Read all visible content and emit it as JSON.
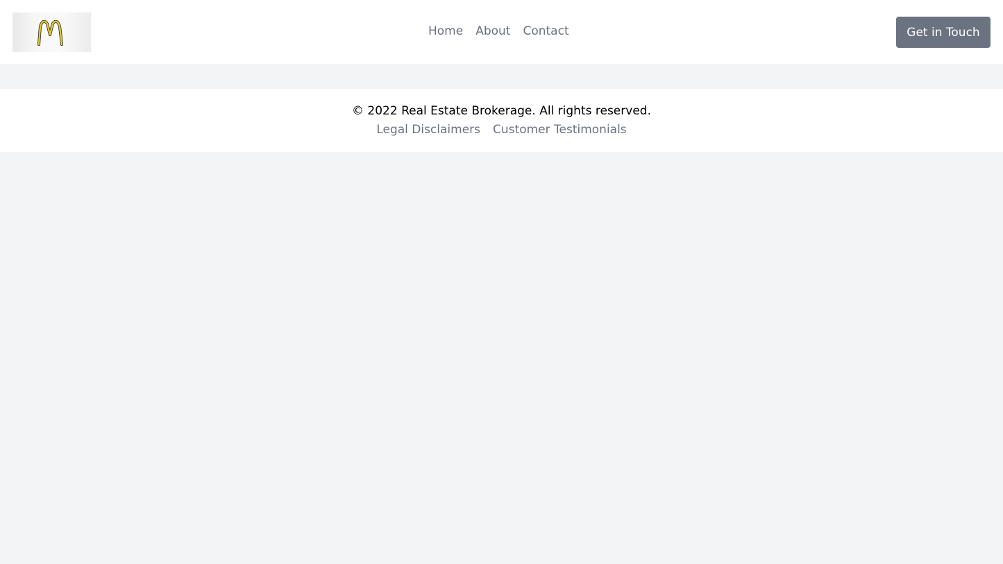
{
  "header": {
    "logo_icon": "golden-arches-logo-icon",
    "nav": [
      {
        "label": "Home"
      },
      {
        "label": "About"
      },
      {
        "label": "Contact"
      }
    ],
    "cta_label": "Get in Touch"
  },
  "footer": {
    "copyright": "© 2022 Real Estate Brokerage. All rights reserved.",
    "links": [
      {
        "label": "Legal Disclaimers"
      },
      {
        "label": "Customer Testimonials"
      }
    ]
  },
  "colors": {
    "page_background": "#f3f4f6",
    "surface": "#ffffff",
    "muted_text": "#6b7280",
    "button_bg": "#6b7280",
    "button_text": "#ffffff"
  }
}
